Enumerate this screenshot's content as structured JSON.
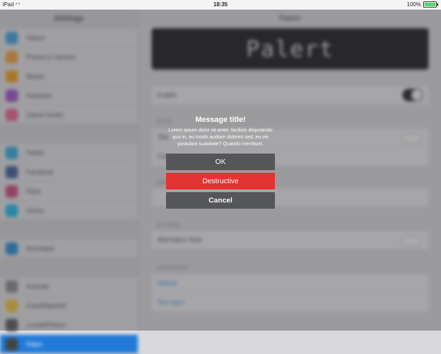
{
  "status_bar": {
    "device": "iPad",
    "time": "18:35",
    "battery": "100%",
    "battery_level": 1.0
  },
  "sidebar": {
    "title": "Settings",
    "groups": [
      [
        {
          "label": "Videos",
          "color": "#3aa0d8"
        },
        {
          "label": "Photos & Camera",
          "color": "#f0a030"
        },
        {
          "label": "iBooks",
          "color": "#f39c12"
        },
        {
          "label": "Podcasts",
          "color": "#9b4dca"
        },
        {
          "label": "Game Center",
          "color": "#e85d8a"
        }
      ],
      [
        {
          "label": "Twitter",
          "color": "#2aa8e0"
        },
        {
          "label": "Facebook",
          "color": "#3b5998"
        },
        {
          "label": "Flickr",
          "color": "#cc4477"
        },
        {
          "label": "Vimeo",
          "color": "#1ab7ea"
        }
      ],
      [
        {
          "label": "Developer",
          "color": "#1f88d8"
        }
      ],
      [
        {
          "label": "Animate",
          "color": "#888888"
        },
        {
          "label": "CrashReporter",
          "color": "#f2c230"
        },
        {
          "label": "LocalAPIStore",
          "color": "#555555"
        },
        {
          "label": "Palert",
          "color": "#444444"
        }
      ]
    ]
  },
  "main": {
    "title": "Palert",
    "logo_text": "Palert",
    "enable_label": "Enable",
    "section_style": "Style",
    "style_rows": [
      "Title",
      "Color"
    ],
    "section_message": "Message",
    "message_value": "",
    "section_buttons": "Buttons",
    "alternative_label": "Alternative Style",
    "section_show": "Show Alert",
    "links": [
      "Default",
      "Text Input"
    ]
  },
  "alert": {
    "title": "Message title!",
    "message": "Lorem ipsum dolor sit amet, facilisis disputando quo in, eu modo audiam dolores sed, eu vix postulant suavitate? Quando mentitum.",
    "ok": "OK",
    "destructive": "Destructive",
    "cancel": "Cancel"
  }
}
